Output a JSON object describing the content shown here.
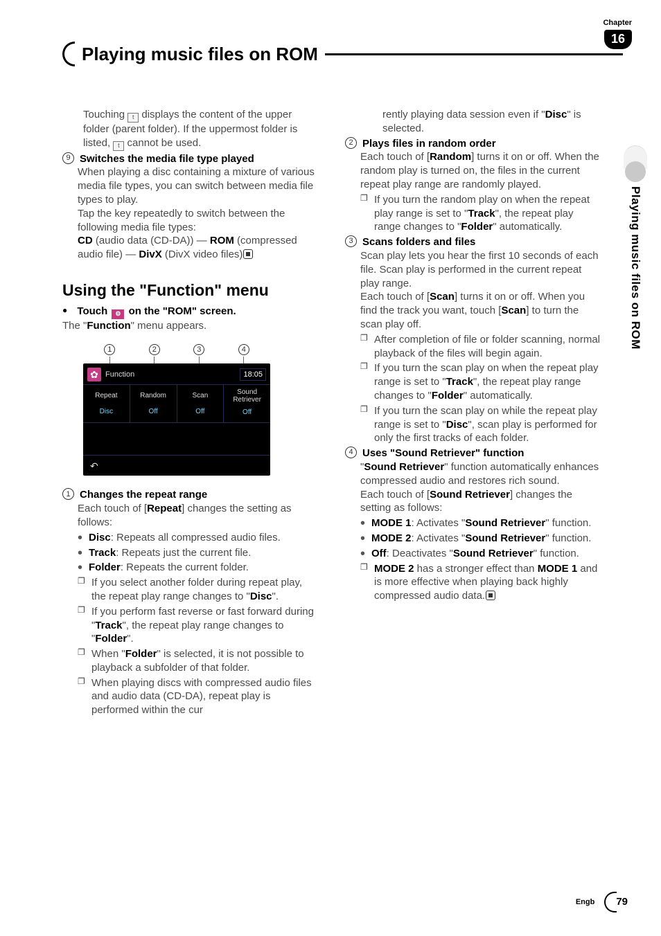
{
  "chapter": {
    "label": "Chapter",
    "number": "16"
  },
  "title": "Playing music files on ROM",
  "sideTab": "Playing music files on ROM",
  "leftCol": {
    "intro1": "Touching ",
    "intro2": " displays the content of the upper folder (parent folder). If the uppermost folder is listed, ",
    "intro3": " cannot be used.",
    "item9": {
      "num": "9",
      "title": "Switches the media file type played",
      "p1": "When playing a disc containing a mixture of various media file types, you can switch between media file types to play.",
      "p2": "Tap the key repeatedly to switch between the following media file types:",
      "p3a": "CD",
      "p3b": " (audio data (CD-DA)) — ",
      "p3c": "ROM",
      "p3d": " (compressed audio file) — ",
      "p3e": "DivX",
      "p3f": " (DivX video files)"
    },
    "h2": "Using the \"Function\" menu",
    "lead": "Touch      on the \"ROM\" screen.",
    "leadLine": "The \"",
    "leadBold": "Function",
    "leadEnd": "\" menu appears.",
    "shot": {
      "nums": [
        "1",
        "2",
        "3",
        "4"
      ],
      "func": "Function",
      "time": "18:05",
      "tabs": [
        {
          "l1": "Repeat",
          "l2": "Disc"
        },
        {
          "l1": "Random",
          "l2": "Off"
        },
        {
          "l1": "Scan",
          "l2": "Off"
        },
        {
          "l1": "Sound Retriever",
          "l2": "Off"
        }
      ],
      "back": "↶"
    },
    "item1": {
      "num": "1",
      "title": "Changes the repeat range",
      "p1a": "Each touch of [",
      "p1b": "Repeat",
      "p1c": "] changes the setting as follows:",
      "bullets": [
        {
          "b": "Disc",
          "t": ": Repeats all compressed audio files."
        },
        {
          "b": "Track",
          "t": ": Repeats just the current file."
        },
        {
          "b": "Folder",
          "t": ": Repeats the current folder."
        }
      ],
      "notes": [
        {
          "pre": "If you select another folder during repeat play, the repeat play range changes to \"",
          "b": "Disc",
          "post": "\"."
        },
        {
          "pre": "If you perform fast reverse or fast forward during \"",
          "b": "Track",
          "mid": "\", the repeat play range changes to \"",
          "b2": "Folder",
          "post": "\"."
        },
        {
          "pre": "When \"",
          "b": "Folder",
          "post": "\" is selected, it is not possible to playback a subfolder of that folder."
        },
        {
          "pre": "When playing discs with compressed audio files and audio data (CD-DA), repeat play is performed within the cur"
        }
      ]
    }
  },
  "rightCol": {
    "cont": {
      "pre": "rently playing data session even if \"",
      "b": "Disc",
      "post": "\" is selected."
    },
    "item2": {
      "num": "2",
      "title": "Plays files in random order",
      "p1a": "Each touch of [",
      "p1b": "Random",
      "p1c": "] turns it on or off. When the random play is turned on, the files in the current repeat play range are randomly played.",
      "note": {
        "pre": "If you turn the random play on when the repeat play range is set to \"",
        "b1": "Track",
        "mid": "\", the repeat play range changes to \"",
        "b2": "Folder",
        "post": "\" automatically."
      }
    },
    "item3": {
      "num": "3",
      "title": "Scans folders and files",
      "p1": "Scan play lets you hear the first 10 seconds of each file. Scan play is performed in the current repeat play range.",
      "p2a": "Each touch of [",
      "p2b": "Scan",
      "p2c": "] turns it on or off. When you find the track you want, touch [",
      "p2d": "Scan",
      "p2e": "] to turn the scan play off.",
      "notes": [
        {
          "pre": "After completion of file or folder scanning, normal playback of the files will begin again."
        },
        {
          "pre": "If you turn the scan play on when the repeat play range is set to \"",
          "b1": "Track",
          "mid": "\", the repeat play range changes to \"",
          "b2": "Folder",
          "post": "\" automatically."
        },
        {
          "pre": "If you turn the scan play on while the repeat play range is set to \"",
          "b1": "Disc",
          "post": "\", scan play is performed for only the first tracks of each folder."
        }
      ]
    },
    "item4": {
      "num": "4",
      "title": "Uses \"Sound Retriever\" function",
      "p1a": "\"",
      "p1b": "Sound Retriever",
      "p1c": "\" function automatically enhances compressed audio and restores rich sound.",
      "p2a": "Each touch of [",
      "p2b": "Sound Retriever",
      "p2c": "] changes the setting as follows:",
      "bullets": [
        {
          "b": "MODE 1",
          "t1": ": Activates \"",
          "b2": "Sound Retriever",
          "t2": "\" function."
        },
        {
          "b": "MODE 2",
          "t1": ": Activates \"",
          "b2": "Sound Retriever",
          "t2": "\" function."
        },
        {
          "b": "Off",
          "t1": ": Deactivates \"",
          "b2": "Sound Retriever",
          "t2": "\" function."
        }
      ],
      "note": {
        "b1": "MODE 2",
        "t1": " has a stronger effect than ",
        "b2": "MODE 1",
        "t2": " and is more effective when playing back highly compressed audio data."
      }
    }
  },
  "footer": {
    "lang": "Engb",
    "page": "79"
  }
}
